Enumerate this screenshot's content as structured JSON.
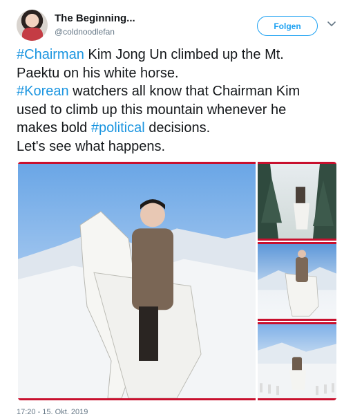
{
  "author": {
    "name": "The Beginning...",
    "handle": "@coldnoodlefan"
  },
  "follow_button": {
    "label": "Folgen"
  },
  "tweet": {
    "lines": [
      [
        {
          "text": "#Chairman",
          "hashtag": true
        },
        {
          "text": " Kim Jong Un climbed up the Mt.",
          "hashtag": false
        }
      ],
      [
        {
          "text": "Paektu on his white horse.",
          "hashtag": false
        }
      ],
      [
        {
          "text": "#Korean",
          "hashtag": true
        },
        {
          "text": " watchers all know that Chairman Kim",
          "hashtag": false
        }
      ],
      [
        {
          "text": "used to climb up this mountain whenever he",
          "hashtag": false
        }
      ],
      [
        {
          "text": "makes bold ",
          "hashtag": false
        },
        {
          "text": "#political",
          "hashtag": true
        },
        {
          "text": " decisions.",
          "hashtag": false
        }
      ],
      [
        {
          "text": "Let's see what happens.",
          "hashtag": false
        }
      ]
    ]
  },
  "media": {
    "photos": [
      {
        "icon": "photo-man-on-white-horse"
      },
      {
        "icon": "photo-rider-in-snowy-forest"
      },
      {
        "icon": "photo-rider-near-mountain"
      },
      {
        "icon": "photo-rider-on-snowy-road"
      }
    ]
  },
  "timestamp": "17:20 - 15. Okt. 2019",
  "colors": {
    "hashtag": "#1b95e0",
    "follow": "#1da1f2",
    "secondary_text": "#657786",
    "photo_border": "#c8102e"
  }
}
